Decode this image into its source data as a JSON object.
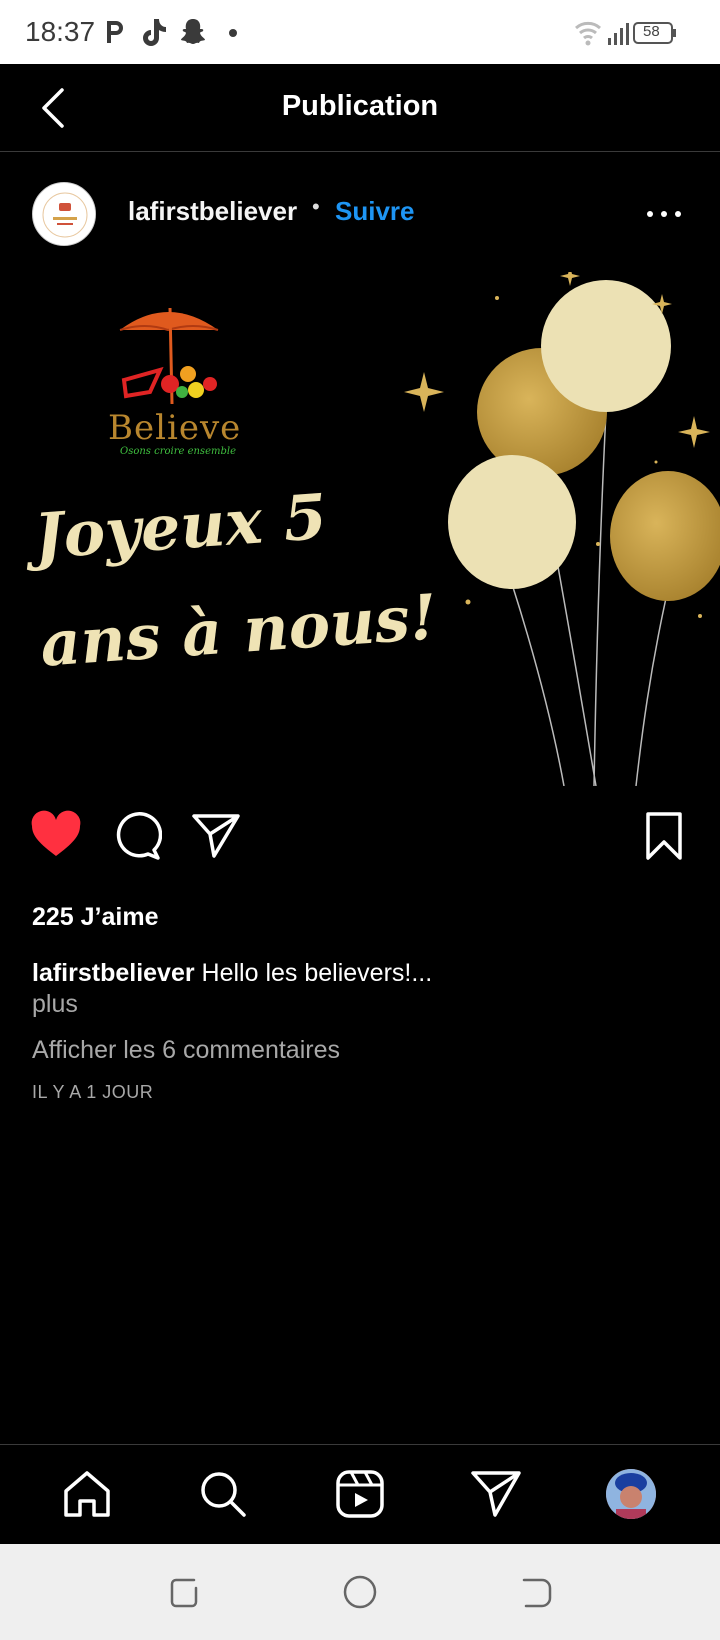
{
  "status_bar": {
    "time": "18:37",
    "battery": "58",
    "notification_icons": [
      "parking-p-icon",
      "tiktok-icon",
      "snapchat-icon",
      "dot-icon"
    ]
  },
  "header": {
    "title": "Publication"
  },
  "post": {
    "username": "lafirstbeliever",
    "separator": "•",
    "follow_label": "Suivre",
    "image": {
      "brand_name": "Believe",
      "brand_tagline": "Osons croire ensemble",
      "greeting_line1": "Joyeux 5",
      "greeting_line2": "ans à nous!",
      "colors": {
        "gold": "#c9a24a",
        "cream": "#efe3b5",
        "background": "#000000"
      }
    },
    "liked": true,
    "likes_text": "225 J’aime",
    "caption_user": "lafirstbeliever",
    "caption_text": "Hello les believers!...",
    "more_label": "plus",
    "comments_link": "Afficher les 6 commentaires",
    "timestamp": "IL Y A 1 JOUR"
  },
  "colors": {
    "accent": "#1e95f4",
    "like_red": "#ff3040",
    "muted": "#a8a8a8"
  },
  "bottom_nav": [
    "home-icon",
    "search-icon",
    "reels-icon",
    "direct-icon",
    "profile-avatar"
  ]
}
